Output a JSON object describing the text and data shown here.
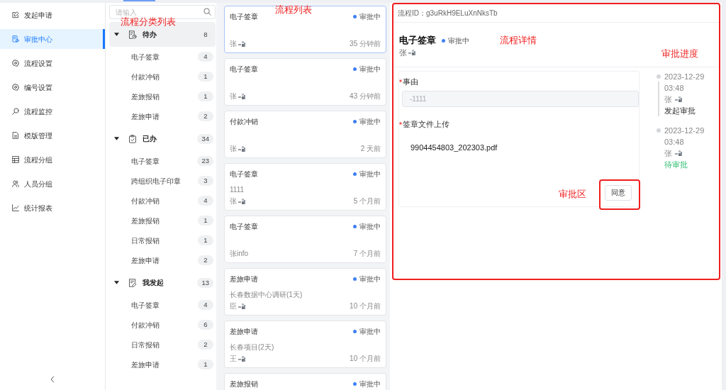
{
  "sidebar": {
    "items": [
      {
        "label": "发起申请",
        "selected": false
      },
      {
        "label": "审批中心",
        "selected": true
      },
      {
        "label": "流程设置",
        "selected": false
      },
      {
        "label": "编号设置",
        "selected": false
      },
      {
        "label": "流程监控",
        "selected": false
      },
      {
        "label": "模版管理",
        "selected": false
      },
      {
        "label": "流程分组",
        "selected": false
      },
      {
        "label": "人员分组",
        "selected": false
      },
      {
        "label": "统计报表",
        "selected": false
      }
    ]
  },
  "category_panel": {
    "annotation": "流程分类列表",
    "search": {
      "placeholder": "请输入"
    },
    "groups": [
      {
        "label": "待办",
        "count": "8",
        "selected": true,
        "expanded": true,
        "children": [
          {
            "label": "电子签章",
            "count": "4"
          },
          {
            "label": "付款冲销",
            "count": "1"
          },
          {
            "label": "差旅报销",
            "count": "1"
          },
          {
            "label": "差旅申请",
            "count": "2"
          }
        ]
      },
      {
        "label": "已办",
        "count": "34",
        "selected": false,
        "expanded": true,
        "children": [
          {
            "label": "电子签章",
            "count": "23"
          },
          {
            "label": "跨组织电子印章",
            "count": "3"
          },
          {
            "label": "付款冲销",
            "count": "4"
          },
          {
            "label": "差旅报销",
            "count": "1"
          },
          {
            "label": "日常报销",
            "count": "1"
          },
          {
            "label": "差旅申请",
            "count": "2"
          }
        ]
      },
      {
        "label": "我发起",
        "count": "13",
        "selected": false,
        "expanded": true,
        "children": [
          {
            "label": "电子签章",
            "count": "4"
          },
          {
            "label": "付款冲销",
            "count": "6"
          },
          {
            "label": "日常报销",
            "count": "2"
          },
          {
            "label": "差旅申请",
            "count": "1"
          }
        ]
      }
    ]
  },
  "flow_list": {
    "annotation": "流程列表",
    "items": [
      {
        "title": "电子签章",
        "status": "审批中",
        "author": "张",
        "redacted": true,
        "time": "35 分钟前",
        "selected": true
      },
      {
        "title": "电子签章",
        "status": "审批中",
        "author": "张",
        "redacted": true,
        "time": "43 分钟前",
        "selected": false
      },
      {
        "title": "付款冲销",
        "status": "审批中",
        "author": "张",
        "redacted": true,
        "time": "2 天前",
        "selected": false
      },
      {
        "title": "电子签章",
        "status": "审批中",
        "subtitle": "1111",
        "author": "张",
        "redacted": true,
        "time": "5 个月前",
        "selected": false
      },
      {
        "title": "电子签章",
        "status": "审批中",
        "author": "张info",
        "redacted": false,
        "time": "7 个月前",
        "selected": false
      },
      {
        "title": "差旅申请",
        "status": "审批中",
        "subtitle": "长春数据中心调研(1天)",
        "author": "臣",
        "redacted": true,
        "time": "10 个月前",
        "selected": false
      },
      {
        "title": "差旅申请",
        "status": "审批中",
        "subtitle": "长春项目(2天)",
        "author": "王",
        "redacted": true,
        "time": "10 个月前",
        "selected": false
      },
      {
        "title": "差旅报销",
        "status": "审批中",
        "selected": false
      }
    ]
  },
  "detail": {
    "framed": true,
    "annotation": "流程详情",
    "flow_id": "流程ID：g3uRkH9ELuXnNksTb",
    "title": "电子签章",
    "status": "审批中",
    "author": "张",
    "redacted": true,
    "fields": [
      {
        "kind": "text",
        "label": "事由",
        "required": true,
        "value": "-1111",
        "disabled": true
      },
      {
        "kind": "file",
        "label": "签章文件上传",
        "required": true,
        "file": "9904454803_202303.pdf"
      }
    ],
    "approval": {
      "annotation": "审批区",
      "framed": true,
      "buttons": [
        "同意"
      ]
    },
    "progress": {
      "annotation": "审批进度",
      "steps": [
        {
          "date": "2023-12-29",
          "time": "03:48",
          "person": "张",
          "redacted": true,
          "action": "发起审批",
          "pending": false
        },
        {
          "date": "2023-12-29",
          "time": "03:48",
          "person": "张",
          "redacted": true,
          "action": "待审批",
          "pending": true
        }
      ]
    }
  }
}
